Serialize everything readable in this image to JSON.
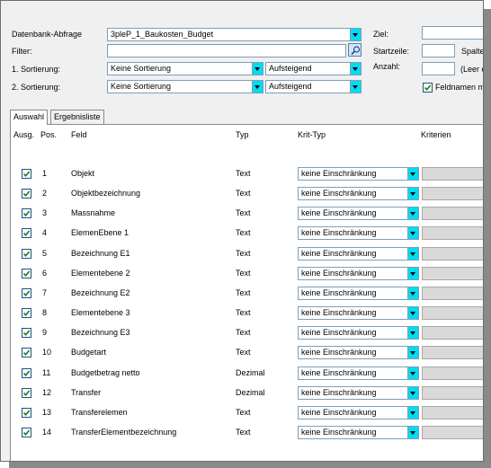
{
  "form": {
    "datenbank_label": "Datenbank-Abfrage",
    "datenbank_value": "3pleP_1_Baukosten_Budget",
    "filter_label": "Filter:",
    "filter_value": "",
    "sort1_label": "1. Sortierung:",
    "sort1_field": "Keine Sortierung",
    "sort1_order": "Aufsteigend",
    "sort2_label": "2. Sortierung:",
    "sort2_field": "Keine Sortierung",
    "sort2_order": "Aufsteigend",
    "ziel_label": "Ziel:",
    "startzeile_label": "Startzeile:",
    "spalte_label": "Spalte:",
    "anzahl_label": "Anzahl:",
    "leer_hint": "(Leer o",
    "feldnamen_label": "Feldnamen mit",
    "feldnamen_checked": true
  },
  "tabs": [
    "Auswahl",
    "Ergebnisliste"
  ],
  "active_tab": "Auswahl",
  "columns": {
    "ausg": "Ausg.",
    "pos": "Pos.",
    "feld": "Feld",
    "typ": "Typ",
    "krit_typ": "Krit-Typ",
    "kriterien": "Kriterien"
  },
  "rows": [
    {
      "checked": true,
      "pos": "1",
      "feld": "Objekt",
      "typ": "Text",
      "krit_typ": "keine Einschränkung"
    },
    {
      "checked": true,
      "pos": "2",
      "feld": "Objektbezeichnung",
      "typ": "Text",
      "krit_typ": "keine Einschränkung"
    },
    {
      "checked": true,
      "pos": "3",
      "feld": "Massnahme",
      "typ": "Text",
      "krit_typ": "keine Einschränkung"
    },
    {
      "checked": true,
      "pos": "4",
      "feld": "ElemenEbene 1",
      "typ": "Text",
      "krit_typ": "keine Einschränkung"
    },
    {
      "checked": true,
      "pos": "5",
      "feld": "Bezeichnung E1",
      "typ": "Text",
      "krit_typ": "keine Einschränkung"
    },
    {
      "checked": true,
      "pos": "6",
      "feld": "Elementebene 2",
      "typ": "Text",
      "krit_typ": "keine Einschränkung"
    },
    {
      "checked": true,
      "pos": "7",
      "feld": "Bezeichnung E2",
      "typ": "Text",
      "krit_typ": "keine Einschränkung"
    },
    {
      "checked": true,
      "pos": "8",
      "feld": "Elementebene 3",
      "typ": "Text",
      "krit_typ": "keine Einschränkung"
    },
    {
      "checked": true,
      "pos": "9",
      "feld": "Bezeichnung E3",
      "typ": "Text",
      "krit_typ": "keine Einschränkung"
    },
    {
      "checked": true,
      "pos": "10",
      "feld": "Budgetart",
      "typ": "Text",
      "krit_typ": "keine Einschränkung"
    },
    {
      "checked": true,
      "pos": "11",
      "feld": "Budgetbetrag netto",
      "typ": "Dezimal",
      "krit_typ": "keine Einschränkung"
    },
    {
      "checked": true,
      "pos": "12",
      "feld": "Transfer",
      "typ": "Dezimal",
      "krit_typ": "keine Einschränkung"
    },
    {
      "checked": true,
      "pos": "13",
      "feld": "Transferelemen",
      "typ": "Text",
      "krit_typ": "keine Einschränkung"
    },
    {
      "checked": true,
      "pos": "14",
      "feld": "TransferElementbezeichnung",
      "typ": "Text",
      "krit_typ": "keine Einschränkung"
    }
  ],
  "colors": {
    "dropdown_button": "#00dcf0",
    "checkbox_border": "#1c5180",
    "checkmark": "#1a7a1a",
    "window_bg": "#f0f0f0"
  }
}
